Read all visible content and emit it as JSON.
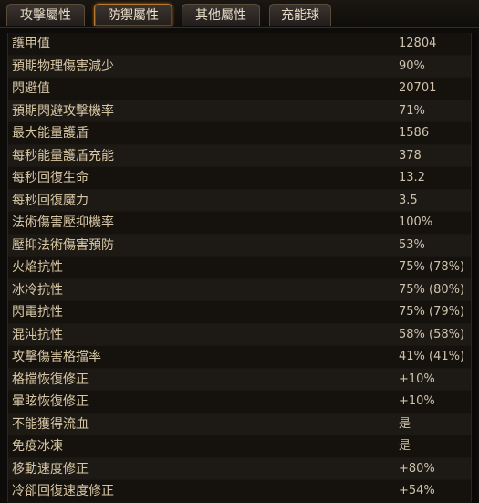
{
  "tabs": [
    {
      "label": "攻擊屬性"
    },
    {
      "label": "防禦屬性"
    },
    {
      "label": "其他屬性"
    },
    {
      "label": "充能球"
    }
  ],
  "active_tab": "防禦屬性",
  "rows": [
    {
      "label": "護甲值",
      "value": "12804"
    },
    {
      "label": "預期物理傷害減少",
      "value": "90%"
    },
    {
      "label": "閃避值",
      "value": "20701"
    },
    {
      "label": "預期閃避攻擊機率",
      "value": "71%"
    },
    {
      "label": "最大能量護盾",
      "value": "1586"
    },
    {
      "label": "每秒能量護盾充能",
      "value": "378"
    },
    {
      "label": "每秒回復生命",
      "value": "13.2"
    },
    {
      "label": "每秒回復魔力",
      "value": "3.5"
    },
    {
      "label": "法術傷害壓抑機率",
      "value": "100%"
    },
    {
      "label": "壓抑法術傷害預防",
      "value": "53%"
    },
    {
      "label": "火焰抗性",
      "value": "75% (78%)"
    },
    {
      "label": "冰冷抗性",
      "value": "75% (80%)"
    },
    {
      "label": "閃電抗性",
      "value": "75% (79%)"
    },
    {
      "label": "混沌抗性",
      "value": "58% (58%)"
    },
    {
      "label": "攻擊傷害格擋率",
      "value": "41% (41%)"
    },
    {
      "label": "格擋恢復修正",
      "value": "+10%"
    },
    {
      "label": "暈眩恢復修正",
      "value": "+10%"
    },
    {
      "label": "不能獲得流血",
      "value": "是"
    },
    {
      "label": "免疫冰凍",
      "value": "是"
    },
    {
      "label": "移動速度修正",
      "value": "+80%"
    },
    {
      "label": "冷卻回復速度修正",
      "value": "+54%"
    }
  ]
}
